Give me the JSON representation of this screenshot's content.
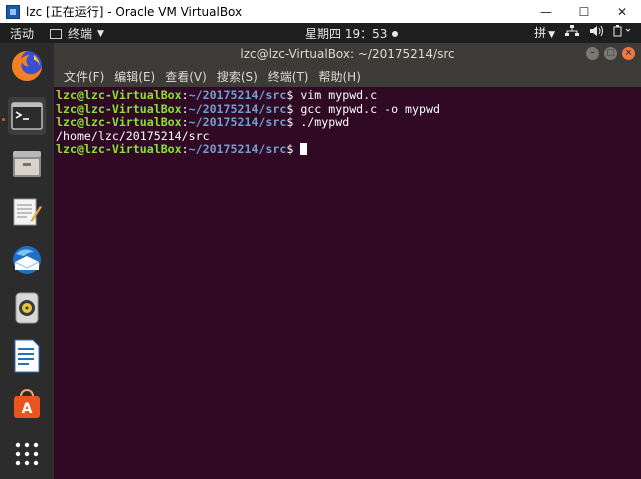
{
  "host_window": {
    "title": "lzc [正在运行] - Oracle VM VirtualBox",
    "minimize_glyph": "—",
    "maximize_glyph": "☐",
    "close_glyph": "✕"
  },
  "topbar": {
    "activities": "活动",
    "app_name": "终端",
    "clock": "星期四 19：53",
    "input_method": "拼"
  },
  "dock": {
    "items": [
      {
        "name": "firefox",
        "icon": "firefox-icon"
      },
      {
        "name": "terminal",
        "icon": "terminal-icon",
        "active": true
      },
      {
        "name": "files",
        "icon": "files-icon"
      },
      {
        "name": "text-editor",
        "icon": "text-editor-icon"
      },
      {
        "name": "thunderbird",
        "icon": "thunderbird-icon"
      },
      {
        "name": "rhythmbox",
        "icon": "rhythmbox-icon"
      },
      {
        "name": "libreoffice-writer",
        "icon": "writer-icon"
      },
      {
        "name": "software-center",
        "icon": "software-center-icon"
      },
      {
        "name": "show-applications",
        "icon": "app-grid-icon"
      }
    ]
  },
  "terminal": {
    "title": "lzc@lzc-VirtualBox: ~/20175214/src",
    "menu": [
      "文件(F)",
      "编辑(E)",
      "查看(V)",
      "搜索(S)",
      "终端(T)",
      "帮助(H)"
    ],
    "prompt_user": "lzc@lzc-VirtualBox",
    "prompt_sep": ":",
    "prompt_path": "~/20175214/src",
    "prompt_end": "$ ",
    "lines": [
      {
        "cmd": "vim mypwd.c"
      },
      {
        "cmd": "gcc mypwd.c -o mypwd"
      },
      {
        "cmd": "./mypwd"
      },
      {
        "output": "/home/lzc/20175214/src"
      },
      {
        "cmd": ""
      }
    ]
  },
  "colors": {
    "terminal_bg": "#300a24",
    "prompt_user": "#8ae234",
    "prompt_path": "#729fcf",
    "accent": "#e95420"
  }
}
